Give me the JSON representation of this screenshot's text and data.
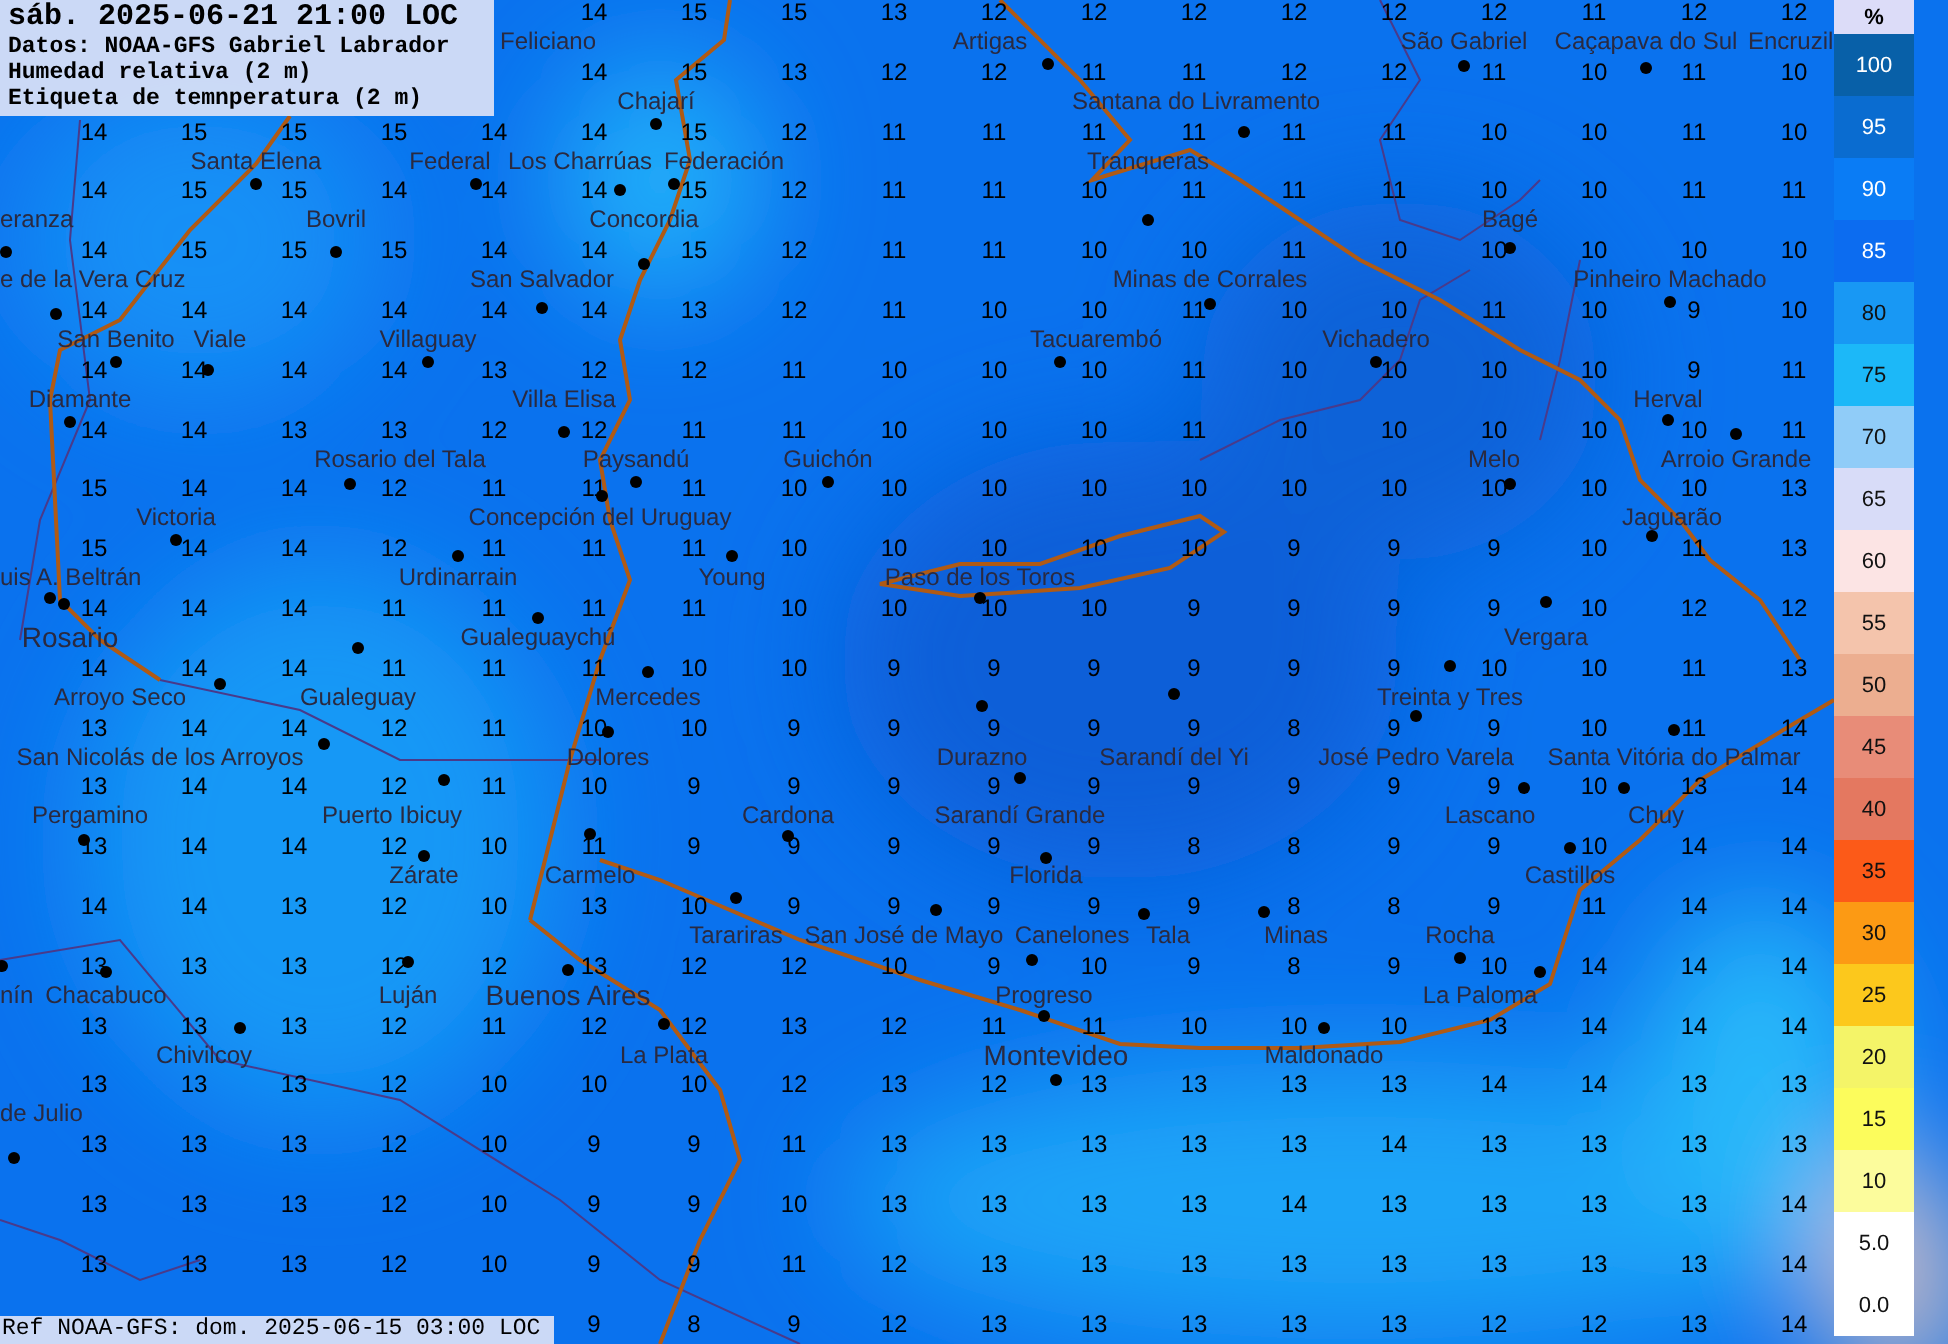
{
  "header": {
    "datetime": "sáb. 2025-06-21 21:00 LOC",
    "source": "Datos: NOAA-GFS Gabriel Labrador",
    "field": "Humedad relativa (2 m)",
    "overlay": "Etiqueta de temnperatura (2 m)"
  },
  "temperature_grid": [
    [
      "14",
      "15",
      "15",
      "13",
      "12",
      "12",
      "12",
      "12",
      "12",
      "12",
      "11",
      "12",
      "12"
    ],
    [
      "14",
      "15",
      "13",
      "12",
      "12",
      "11",
      "11",
      "12",
      "12",
      "11",
      "10",
      "11",
      "10"
    ],
    [
      "14",
      "15",
      "15",
      "15",
      "14",
      "14",
      "15",
      "12",
      "11",
      "11",
      "11",
      "11",
      "11",
      "11",
      "10",
      "10",
      "11",
      "10"
    ],
    [
      "14",
      "15",
      "15",
      "14",
      "14",
      "14",
      "15",
      "12",
      "11",
      "11",
      "10",
      "11",
      "11",
      "11",
      "10",
      "10",
      "11",
      "11"
    ],
    [
      "14",
      "15",
      "15",
      "15",
      "14",
      "14",
      "15",
      "12",
      "11",
      "11",
      "10",
      "10",
      "11",
      "10",
      "10",
      "10",
      "10",
      "10"
    ],
    [
      "14",
      "14",
      "14",
      "14",
      "14",
      "14",
      "13",
      "12",
      "11",
      "10",
      "10",
      "11",
      "10",
      "10",
      "11",
      "10",
      "9",
      "10"
    ],
    [
      "14",
      "14",
      "14",
      "14",
      "13",
      "12",
      "12",
      "11",
      "10",
      "10",
      "10",
      "11",
      "10",
      "10",
      "10",
      "10",
      "9",
      "11"
    ],
    [
      "14",
      "14",
      "13",
      "13",
      "12",
      "12",
      "11",
      "11",
      "10",
      "10",
      "10",
      "11",
      "10",
      "10",
      "10",
      "10",
      "10",
      "11"
    ],
    [
      "15",
      "14",
      "14",
      "12",
      "11",
      "11",
      "11",
      "10",
      "10",
      "10",
      "10",
      "10",
      "10",
      "10",
      "10",
      "10",
      "10",
      "13"
    ],
    [
      "15",
      "14",
      "14",
      "12",
      "11",
      "11",
      "11",
      "10",
      "10",
      "10",
      "10",
      "10",
      "9",
      "9",
      "9",
      "10",
      "11",
      "13"
    ],
    [
      "14",
      "14",
      "14",
      "11",
      "11",
      "11",
      "11",
      "10",
      "10",
      "10",
      "10",
      "9",
      "9",
      "9",
      "9",
      "10",
      "12",
      "12"
    ],
    [
      "14",
      "14",
      "14",
      "11",
      "11",
      "11",
      "10",
      "10",
      "9",
      "9",
      "9",
      "9",
      "9",
      "9",
      "10",
      "10",
      "11",
      "13"
    ],
    [
      "13",
      "14",
      "14",
      "12",
      "11",
      "10",
      "10",
      "9",
      "9",
      "9",
      "9",
      "9",
      "8",
      "9",
      "9",
      "10",
      "11",
      "14"
    ],
    [
      "13",
      "14",
      "14",
      "12",
      "11",
      "10",
      "9",
      "9",
      "9",
      "9",
      "9",
      "9",
      "9",
      "9",
      "9",
      "10",
      "13",
      "14"
    ],
    [
      "13",
      "14",
      "14",
      "12",
      "10",
      "11",
      "9",
      "9",
      "9",
      "9",
      "9",
      "8",
      "8",
      "9",
      "9",
      "10",
      "14",
      "14"
    ],
    [
      "14",
      "14",
      "13",
      "12",
      "10",
      "13",
      "10",
      "9",
      "9",
      "9",
      "9",
      "9",
      "8",
      "8",
      "9",
      "11",
      "14",
      "14"
    ],
    [
      "13",
      "13",
      "13",
      "12",
      "12",
      "13",
      "12",
      "12",
      "10",
      "9",
      "10",
      "9",
      "8",
      "9",
      "10",
      "14",
      "14",
      "14"
    ],
    [
      "13",
      "13",
      "13",
      "12",
      "11",
      "12",
      "12",
      "13",
      "12",
      "11",
      "11",
      "10",
      "10",
      "10",
      "13",
      "14",
      "14",
      "14"
    ],
    [
      "13",
      "13",
      "13",
      "12",
      "10",
      "10",
      "10",
      "12",
      "13",
      "12",
      "13",
      "13",
      "13",
      "13",
      "14",
      "14",
      "13",
      "13"
    ],
    [
      "13",
      "13",
      "13",
      "12",
      "10",
      "9",
      "9",
      "11",
      "13",
      "13",
      "13",
      "13",
      "13",
      "14",
      "13",
      "13",
      "13",
      "13"
    ],
    [
      "13",
      "13",
      "13",
      "12",
      "10",
      "9",
      "9",
      "10",
      "13",
      "13",
      "13",
      "13",
      "14",
      "13",
      "13",
      "13",
      "13",
      "14"
    ],
    [
      "13",
      "13",
      "13",
      "12",
      "10",
      "9",
      "9",
      "11",
      "12",
      "13",
      "13",
      "13",
      "13",
      "13",
      "13",
      "13",
      "13",
      "14"
    ],
    [
      "9",
      "8",
      "9",
      "12",
      "13",
      "13",
      "13",
      "13",
      "13",
      "12",
      "12",
      "13",
      "14"
    ]
  ],
  "cities": [
    {
      "name": "Feliciano",
      "kind": "partial"
    },
    {
      "name": "Artigas",
      "kind": "town"
    },
    {
      "name": "São Gabriel",
      "kind": "town"
    },
    {
      "name": "Caçapava do Sul",
      "kind": "town"
    },
    {
      "name": "Encruzil",
      "kind": "partial"
    },
    {
      "name": "Chajarí",
      "kind": "town"
    },
    {
      "name": "Santana do Livramento",
      "kind": "town"
    },
    {
      "name": "Santa Elena",
      "kind": "town"
    },
    {
      "name": "Federal",
      "kind": "town"
    },
    {
      "name": "Los Charrúas",
      "kind": "town"
    },
    {
      "name": "Federación",
      "kind": "town"
    },
    {
      "name": "Tranqueras",
      "kind": "town"
    },
    {
      "name": "eranza",
      "kind": "edge"
    },
    {
      "name": "Bovril",
      "kind": "town"
    },
    {
      "name": "Concordia",
      "kind": "town"
    },
    {
      "name": "Bagé",
      "kind": "town"
    },
    {
      "name": "e de la Vera Cruz",
      "kind": "edge"
    },
    {
      "name": "San Salvador",
      "kind": "town"
    },
    {
      "name": "Minas de Corrales",
      "kind": "town"
    },
    {
      "name": "Pinheiro Machado",
      "kind": "town"
    },
    {
      "name": "San Benito",
      "kind": "town"
    },
    {
      "name": "Viale",
      "kind": "town"
    },
    {
      "name": "Villaguay",
      "kind": "town"
    },
    {
      "name": "Tacuarembó",
      "kind": "town"
    },
    {
      "name": "Vichadero",
      "kind": "town"
    },
    {
      "name": "Diamante",
      "kind": "town"
    },
    {
      "name": "Villa Elisa",
      "kind": "town"
    },
    {
      "name": "Herval",
      "kind": "town"
    },
    {
      "name": "Rosario del Tala",
      "kind": "town"
    },
    {
      "name": "Paysandú",
      "kind": "town"
    },
    {
      "name": "Guichón",
      "kind": "town"
    },
    {
      "name": "Melo",
      "kind": "town"
    },
    {
      "name": "Arroio Grande",
      "kind": "town"
    },
    {
      "name": "Victoria",
      "kind": "town"
    },
    {
      "name": "Concepción del Uruguay",
      "kind": "town"
    },
    {
      "name": "Jaguarão",
      "kind": "town"
    },
    {
      "name": "uis A. Beltrán",
      "kind": "edge"
    },
    {
      "name": "Urdinarrain",
      "kind": "town"
    },
    {
      "name": "Young",
      "kind": "town"
    },
    {
      "name": "Paso de los Toros",
      "kind": "town"
    },
    {
      "name": "Rosario",
      "kind": "major"
    },
    {
      "name": "Gualeguaychú",
      "kind": "town"
    },
    {
      "name": "Vergara",
      "kind": "town"
    },
    {
      "name": "Arroyo Seco",
      "kind": "town"
    },
    {
      "name": "Gualeguay",
      "kind": "town"
    },
    {
      "name": "Mercedes",
      "kind": "town"
    },
    {
      "name": "Treinta y Tres",
      "kind": "town"
    },
    {
      "name": "San Nicolás de los Arroyos",
      "kind": "town"
    },
    {
      "name": "Dolores",
      "kind": "town"
    },
    {
      "name": "Durazno",
      "kind": "town"
    },
    {
      "name": "Sarandí del Yi",
      "kind": "town"
    },
    {
      "name": "José Pedro Varela",
      "kind": "town"
    },
    {
      "name": "Santa Vitória do Palmar",
      "kind": "town"
    },
    {
      "name": "Pergamino",
      "kind": "town"
    },
    {
      "name": "Puerto Ibicuy",
      "kind": "town"
    },
    {
      "name": "Cardona",
      "kind": "town"
    },
    {
      "name": "Sarandí Grande",
      "kind": "town"
    },
    {
      "name": "Lascano",
      "kind": "town"
    },
    {
      "name": "Chuy",
      "kind": "town"
    },
    {
      "name": "Zárate",
      "kind": "town"
    },
    {
      "name": "Carmelo",
      "kind": "town"
    },
    {
      "name": "Florida",
      "kind": "town"
    },
    {
      "name": "Castillos",
      "kind": "town"
    },
    {
      "name": "Tarariras",
      "kind": "town"
    },
    {
      "name": "San José de Mayo",
      "kind": "town"
    },
    {
      "name": "Canelones",
      "kind": "town"
    },
    {
      "name": "Tala",
      "kind": "town"
    },
    {
      "name": "Minas",
      "kind": "town"
    },
    {
      "name": "Rocha",
      "kind": "town"
    },
    {
      "name": "nín",
      "kind": "edge"
    },
    {
      "name": "Chacabuco",
      "kind": "town"
    },
    {
      "name": "Luján",
      "kind": "town"
    },
    {
      "name": "Buenos Aires",
      "kind": "major"
    },
    {
      "name": "Progreso",
      "kind": "town"
    },
    {
      "name": "La Paloma",
      "kind": "town"
    },
    {
      "name": "Chivilcoy",
      "kind": "town"
    },
    {
      "name": "La Plata",
      "kind": "town"
    },
    {
      "name": "Montevideo",
      "kind": "major"
    },
    {
      "name": "Maldonado",
      "kind": "town"
    },
    {
      "name": "de Julio",
      "kind": "edge"
    }
  ],
  "legend": {
    "unit": "%",
    "items": [
      {
        "label": "100",
        "color": "#0860a8"
      },
      {
        "label": "95",
        "color": "#0a6cd0"
      },
      {
        "label": "90",
        "color": "#0a7cf5"
      },
      {
        "label": "85",
        "color": "#0c6cf0"
      },
      {
        "label": "80",
        "color": "#1898f4"
      },
      {
        "label": "75",
        "color": "#1cb8f8"
      },
      {
        "label": "70",
        "color": "#90ccf8"
      },
      {
        "label": "65",
        "color": "#d8dcf8"
      },
      {
        "label": "60",
        "color": "#fce4e4"
      },
      {
        "label": "55",
        "color": "#f4c4ac"
      },
      {
        "label": "50",
        "color": "#ecae90"
      },
      {
        "label": "45",
        "color": "#e88c78"
      },
      {
        "label": "40",
        "color": "#e47860"
      },
      {
        "label": "35",
        "color": "#fc5a18"
      },
      {
        "label": "30",
        "color": "#fc9a14"
      },
      {
        "label": "25",
        "color": "#fcc81c"
      },
      {
        "label": "20",
        "color": "#f4f468"
      },
      {
        "label": "15",
        "color": "#fcfc5c"
      },
      {
        "label": "10",
        "color": "#fcfc9c"
      },
      {
        "label": "5.0",
        "color": "#ffffff"
      },
      {
        "label": "0.0",
        "color": "#ffffff"
      }
    ]
  },
  "footer": "Ref NOAA-GFS: dom. 2025-06-15 03:00 LOC"
}
